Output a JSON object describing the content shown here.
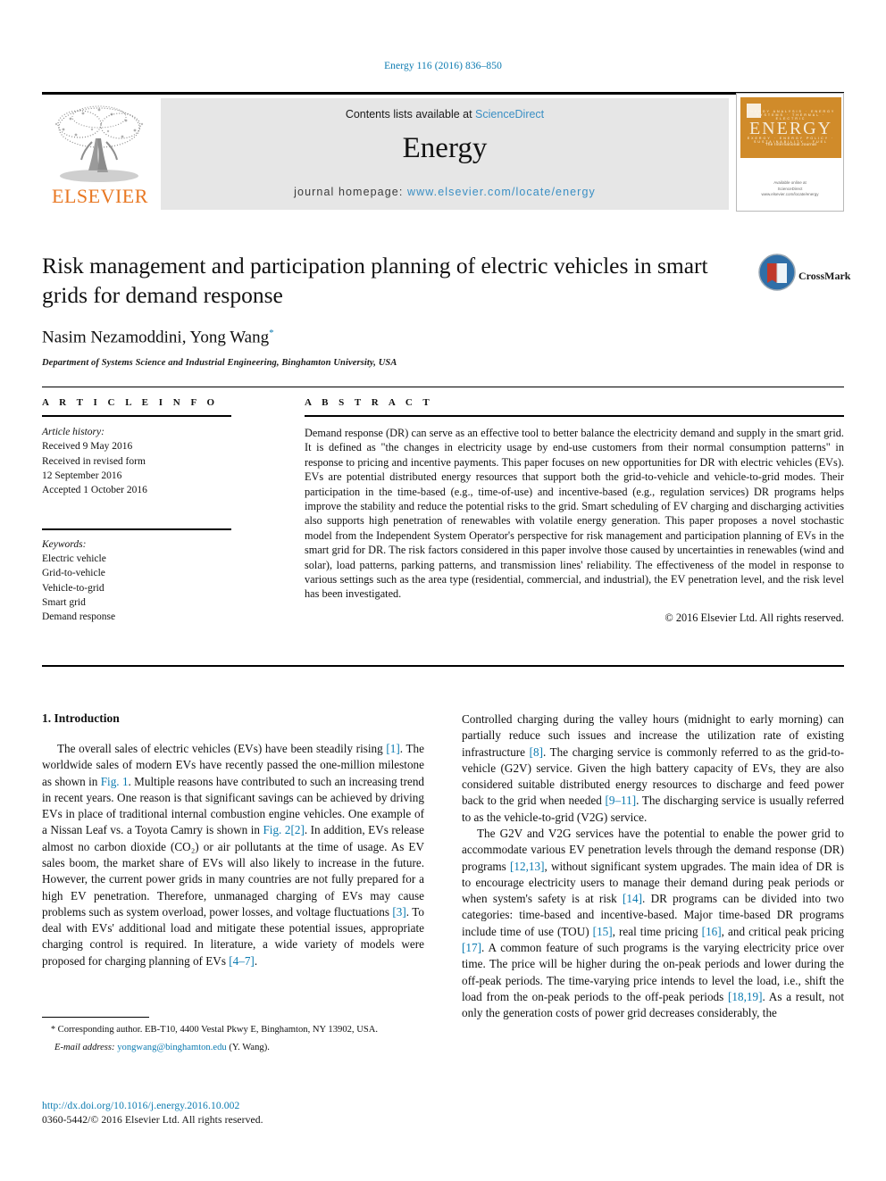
{
  "running_head": "Energy 116 (2016) 836–850",
  "masthead": {
    "publisher_name": "ELSEVIER",
    "contents_prefix": "Contents lists available at ",
    "contents_link": "ScienceDirect",
    "journal_title": "Energy",
    "homepage_label": "journal homepage: ",
    "homepage_url": "www.elsevier.com/locate/energy",
    "cover": {
      "journal_name": "ENERGY",
      "tagline": "The International Journal",
      "top_row": "ENERGY ANALYSIS · ENERGY SYSTEMS · THERMAL · ELECTRIC",
      "bottom_row": "EXERGY · ENERGY POLICY · SUSTAINABILITY · FUEL",
      "publisher_footer": "Available online at",
      "publisher_footer2": "ScienceDirect",
      "publisher_footer3": "www.elsevier.com/locate/energy"
    }
  },
  "article": {
    "title": "Risk management and participation planning of electric vehicles in smart grids for demand response",
    "authors": "Nasim Nezamoddini, Yong Wang",
    "corresponding_marker": "*",
    "affiliation": "Department of Systems Science and Industrial Engineering, Binghamton University, USA",
    "crossmark_label": "CrossMark"
  },
  "article_info": {
    "heading": "A R T I C L E   I N F O",
    "history_label": "Article history:",
    "history_lines": [
      "Received 9 May 2016",
      "Received in revised form",
      "12 September 2016",
      "Accepted 1 October 2016"
    ],
    "keywords_label": "Keywords:",
    "keywords": [
      "Electric vehicle",
      "Grid-to-vehicle",
      "Vehicle-to-grid",
      "Smart grid",
      "Demand response"
    ]
  },
  "abstract": {
    "heading": "A B S T R A C T",
    "text": "Demand response (DR) can serve as an effective tool to better balance the electricity demand and supply in the smart grid. It is defined as \"the changes in electricity usage by end-use customers from their normal consumption patterns\" in response to pricing and incentive payments. This paper focuses on new opportunities for DR with electric vehicles (EVs). EVs are potential distributed energy resources that support both the grid-to-vehicle and vehicle-to-grid modes. Their participation in the time-based (e.g., time-of-use) and incentive-based (e.g., regulation services) DR programs helps improve the stability and reduce the potential risks to the grid. Smart scheduling of EV charging and discharging activities also supports high penetration of renewables with volatile energy generation. This paper proposes a novel stochastic model from the Independent System Operator's perspective for risk management and participation planning of EVs in the smart grid for DR. The risk factors considered in this paper involve those caused by uncertainties in renewables (wind and solar), load patterns, parking patterns, and transmission lines' reliability. The effectiveness of the model in response to various settings such as the area type (residential, commercial, and industrial), the EV penetration level, and the risk level has been investigated.",
    "copyright": "© 2016 Elsevier Ltd. All rights reserved."
  },
  "body": {
    "section_title": "1.  Introduction",
    "left_paragraph_1_a": "The overall sales of electric vehicles (EVs) have been steadily rising ",
    "left_ref_1": "[1]",
    "left_paragraph_1_b": ". The worldwide sales of modern EVs have recently passed the one-million milestone as shown in ",
    "left_ref_fig1": "Fig. 1",
    "left_paragraph_1_c": ". Multiple reasons have contributed to such an increasing trend in recent years. One reason is that significant savings can be achieved by driving EVs in place of traditional internal combustion engine vehicles. One example of a Nissan Leaf vs. a Toyota Camry is shown in ",
    "left_ref_fig2": "Fig. 2[2]",
    "left_paragraph_1_d": ". In addition, EVs release almost no carbon dioxide (CO₂) or air pollutants at the time of usage. As EV sales boom, the market share of EVs will also likely to increase in the future. However, the current power grids in many countries are not fully prepared for a high EV penetration. Therefore, unmanaged charging of EVs may cause problems such as system overload, power losses, and voltage fluctuations ",
    "left_ref_3": "[3]",
    "left_paragraph_1_e": ". To deal with EVs' additional load and mitigate these potential issues, appropriate charging control is required. In literature, a wide variety of models were proposed for charging planning of EVs ",
    "left_ref_47": "[4–7]",
    "left_paragraph_1_f": ".",
    "right_paragraph_1_a": "Controlled charging during the valley hours (midnight to early morning) can partially reduce such issues and increase the utilization rate of existing infrastructure ",
    "right_ref_8": "[8]",
    "right_paragraph_1_b": ". The charging service is commonly referred to as the grid-to-vehicle (G2V) service. Given the high battery capacity of EVs, they are also considered suitable distributed energy resources to discharge and feed power back to the grid when needed ",
    "right_ref_911": "[9–11]",
    "right_paragraph_1_c": ". The discharging service is usually referred to as the vehicle-to-grid (V2G) service.",
    "right_paragraph_2_a": "The G2V and V2G services have the potential to enable the power grid to accommodate various EV penetration levels through the demand response (DR) programs ",
    "right_ref_1213": "[12,13]",
    "right_paragraph_2_b": ", without significant system upgrades. The main idea of DR is to encourage electricity users to manage their demand during peak periods or when system's safety is at risk ",
    "right_ref_14": "[14]",
    "right_paragraph_2_c": ". DR programs can be divided into two categories: time-based and incentive-based. Major time-based DR programs include time of use (TOU) ",
    "right_ref_15": "[15]",
    "right_paragraph_2_d": ", real time pricing ",
    "right_ref_16": "[16]",
    "right_paragraph_2_e": ", and critical peak pricing ",
    "right_ref_17": "[17]",
    "right_paragraph_2_f": ". A common feature of such programs is the varying electricity price over time. The price will be higher during the on-peak periods and lower during the off-peak periods. The time-varying price intends to level the load, i.e., shift the load from the on-peak periods to the off-peak periods ",
    "right_ref_1819": "[18,19]",
    "right_paragraph_2_g": ". As a result, not only the generation costs of power grid decreases considerably, the"
  },
  "footnotes": {
    "corresponding_star": "*",
    "corresponding_text": " Corresponding author. EB-T10, 4400 Vestal Pkwy E, Binghamton, NY 13902, USA.",
    "email_label": "E-mail address:",
    "email": "yongwang@binghamton.edu",
    "email_suffix": " (Y. Wang).",
    "doi": "http://dx.doi.org/10.1016/j.energy.2016.10.002",
    "issn": "0360-5442/© 2016 Elsevier Ltd. All rights reserved."
  },
  "colors": {
    "link": "#0b7ab0",
    "elsevier_orange": "#E87722",
    "banner_bg": "#e6e6e6"
  }
}
